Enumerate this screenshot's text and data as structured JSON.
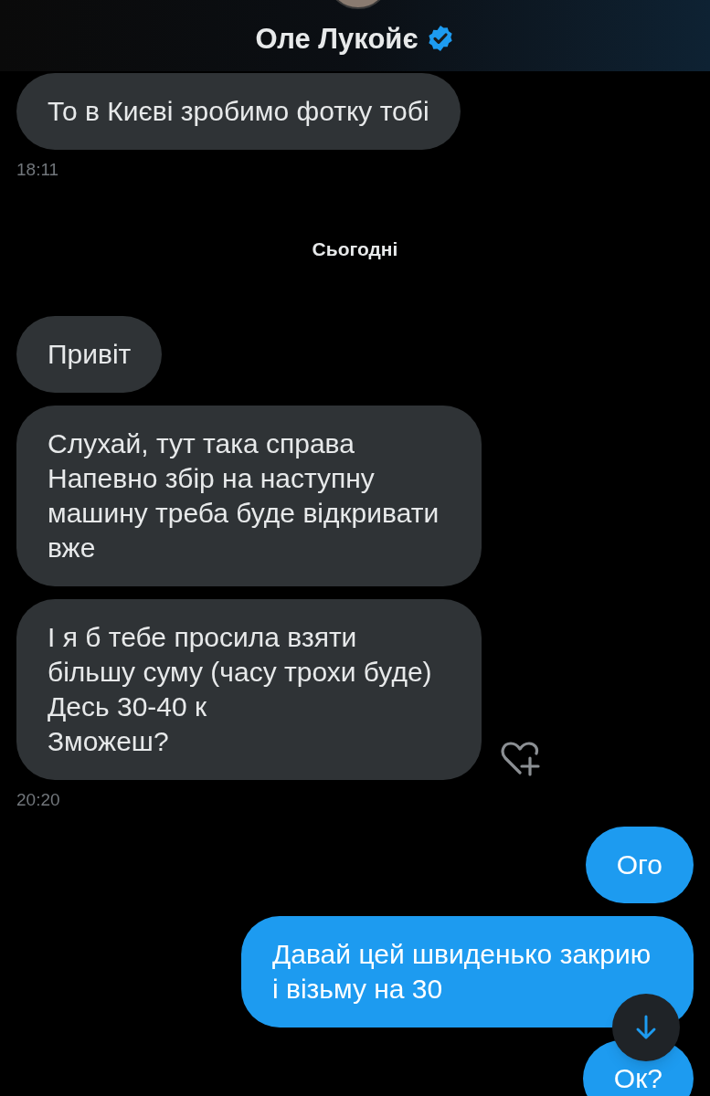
{
  "header": {
    "name": "Оле Лукойє",
    "verified": true
  },
  "messages": [
    {
      "kind": "received",
      "text": "То в Києві зробимо фотку тобі",
      "react_button": false
    },
    {
      "kind": "time",
      "text": "18:11"
    },
    {
      "kind": "date",
      "text": "Сьогодні"
    },
    {
      "kind": "received",
      "text": "Привіт",
      "react_button": false
    },
    {
      "kind": "received",
      "text": "Слухай, тут така справа\nНапевно збір на наступну машину треба буде відкривати вже",
      "react_button": false
    },
    {
      "kind": "received",
      "text": "І я б тебе просила взяти більшу суму (часу трохи буде)\nДесь 30-40 к\nЗможеш?",
      "react_button": true
    },
    {
      "kind": "time",
      "text": "20:20"
    },
    {
      "kind": "sent",
      "text": "Ого"
    },
    {
      "kind": "sent",
      "text": "Давай цей швиденько закрию і візьму на 30"
    },
    {
      "kind": "sent",
      "text": "Ок?"
    }
  ],
  "scroll_down_button": true
}
